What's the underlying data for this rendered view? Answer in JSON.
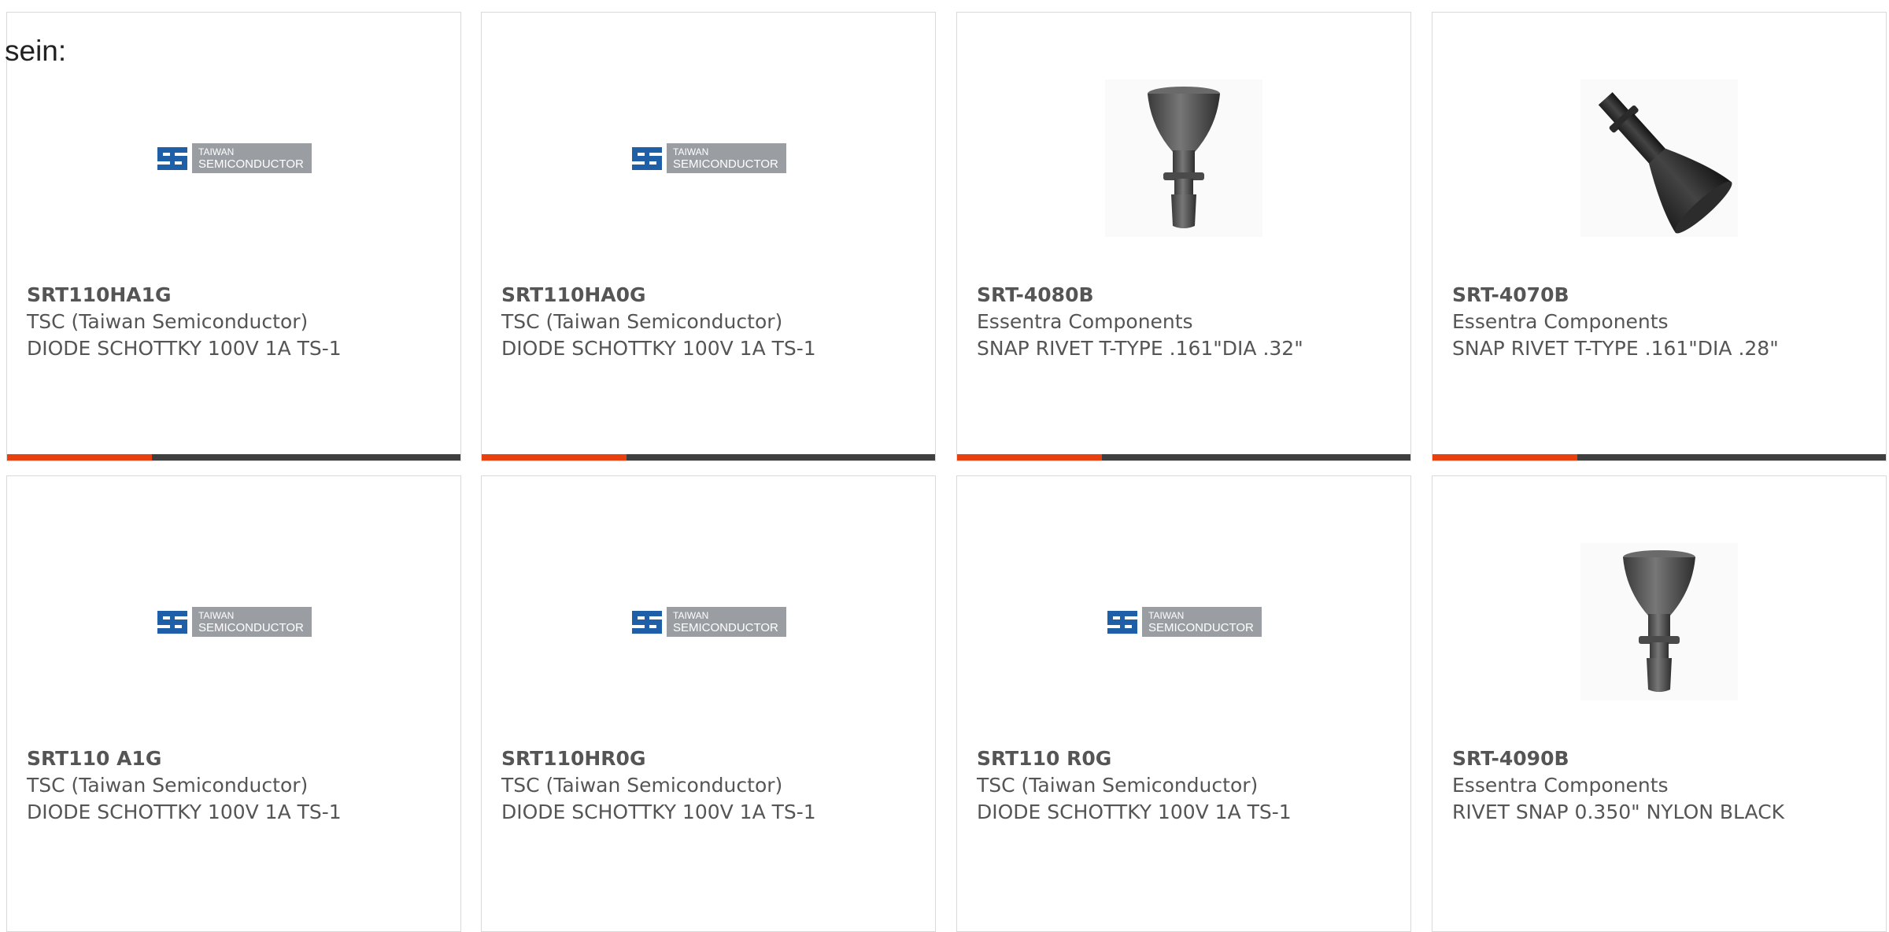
{
  "intro": "sein:",
  "colors": {
    "accent": "#e8400e",
    "bar_track": "#3f3f3f",
    "text": "#555555",
    "card_border": "#d9d9d9"
  },
  "logo": {
    "line1": "TAIWAN",
    "line2": "SEMICONDUCTOR"
  },
  "products": [
    {
      "part_number": "SRT110HA1G",
      "manufacturer": "TSC (Taiwan Semiconductor)",
      "description": "DIODE SCHOTTKY 100V 1A TS-1",
      "image": "tsc-logo",
      "progress": 0.32
    },
    {
      "part_number": "SRT110HA0G",
      "manufacturer": "TSC (Taiwan Semiconductor)",
      "description": "DIODE SCHOTTKY 100V 1A TS-1",
      "image": "tsc-logo",
      "progress": 0.32
    },
    {
      "part_number": "SRT-4080B",
      "manufacturer": "Essentra Components",
      "description": "SNAP RIVET T-TYPE .161\"DIA .32\"",
      "image": "rivet-upright",
      "progress": 0.32
    },
    {
      "part_number": "SRT-4070B",
      "manufacturer": "Essentra Components",
      "description": "SNAP RIVET T-TYPE .161\"DIA .28\"",
      "image": "rivet-tilted",
      "progress": 0.32
    },
    {
      "part_number": "SRT110 A1G",
      "manufacturer": "TSC (Taiwan Semiconductor)",
      "description": "DIODE SCHOTTKY 100V 1A TS-1",
      "image": "tsc-logo"
    },
    {
      "part_number": "SRT110HR0G",
      "manufacturer": "TSC (Taiwan Semiconductor)",
      "description": "DIODE SCHOTTKY 100V 1A TS-1",
      "image": "tsc-logo"
    },
    {
      "part_number": "SRT110 R0G",
      "manufacturer": "TSC (Taiwan Semiconductor)",
      "description": "DIODE SCHOTTKY 100V 1A TS-1",
      "image": "tsc-logo"
    },
    {
      "part_number": "SRT-4090B",
      "manufacturer": "Essentra Components",
      "description": "RIVET SNAP 0.350\" NYLON BLACK",
      "image": "rivet-upright"
    }
  ]
}
